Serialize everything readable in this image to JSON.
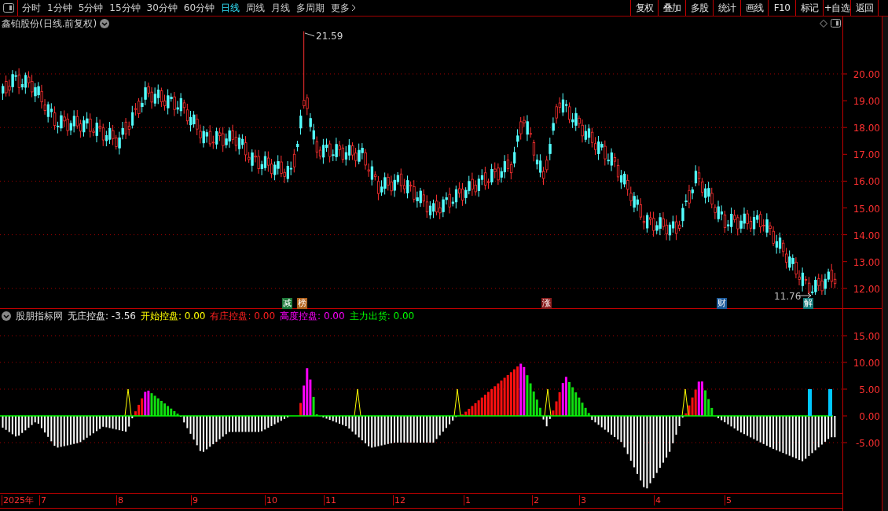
{
  "toolbar": {
    "periods": [
      {
        "label": "分时",
        "selected": false
      },
      {
        "label": "1分钟",
        "selected": false
      },
      {
        "label": "5分钟",
        "selected": false
      },
      {
        "label": "15分钟",
        "selected": false
      },
      {
        "label": "30分钟",
        "selected": false
      },
      {
        "label": "60分钟",
        "selected": false
      },
      {
        "label": "日线",
        "selected": true
      },
      {
        "label": "周线",
        "selected": false
      },
      {
        "label": "月线",
        "selected": false
      },
      {
        "label": "多周期",
        "selected": false
      },
      {
        "label": "更多",
        "selected": false
      }
    ],
    "buttons": [
      "复权",
      "叠加",
      "多股",
      "统计",
      "画线",
      "F10",
      "标记",
      "+自选",
      "返回"
    ]
  },
  "price_chart": {
    "title": "鑫铂股份(日线.前复权)",
    "axis_labels": [
      "20.00",
      "19.00",
      "18.00",
      "17.00",
      "16.00",
      "15.00",
      "14.00",
      "13.00",
      "12.00"
    ],
    "max_label": "21.59",
    "min_label": "11.76",
    "event_tags": [
      {
        "text": "减",
        "color": "#1e7a3a"
      },
      {
        "text": "榜",
        "color": "#b0601a"
      },
      {
        "text": "涨",
        "color": "#8a1c1c"
      },
      {
        "text": "财",
        "color": "#1c5a9a"
      },
      {
        "text": "解",
        "color": "#127a7a"
      }
    ]
  },
  "indicator": {
    "name": "股朋指标网",
    "values": [
      {
        "text": "无庄控盘: -3.56",
        "color": "#e8e8e8"
      },
      {
        "text": "开始控盘: 0.00",
        "color": "#ffff00"
      },
      {
        "text": "有庄控盘: 0.00",
        "color": "#ff2020"
      },
      {
        "text": "高度控盘: 0.00",
        "color": "#ff00ff"
      },
      {
        "text": "主力出货: 0.00",
        "color": "#00ff00"
      }
    ],
    "axis_labels": [
      "15.00",
      "10.00",
      "5.00",
      "0.00",
      "-5.00"
    ]
  },
  "date_axis": [
    "2025年",
    "7",
    "8",
    "9",
    "10",
    "11",
    "12",
    "1",
    "2",
    "3",
    "4",
    "5"
  ]
}
